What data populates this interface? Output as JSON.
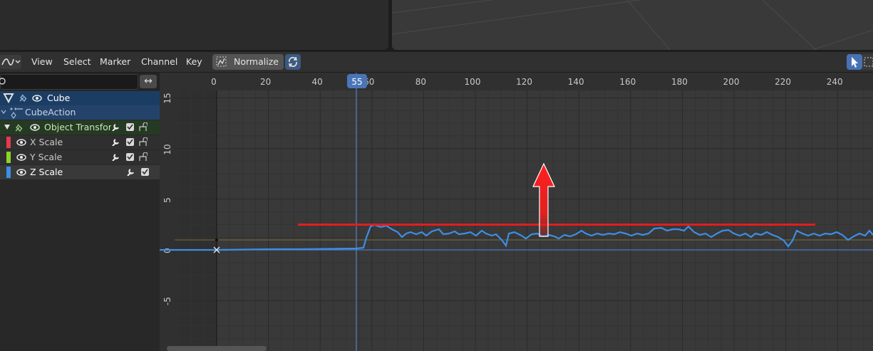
{
  "viewport": {},
  "header": {
    "menus": [
      "View",
      "Select",
      "Marker",
      "Channel",
      "Key"
    ],
    "normalize_label": "Normalize"
  },
  "channels": {
    "object": "Cube",
    "action": "CubeAction",
    "group": "Object Transform",
    "curves": [
      {
        "label": "X Scale",
        "color": "#e63a4e"
      },
      {
        "label": "Y Scale",
        "color": "#8bd426"
      },
      {
        "label": "Z Scale",
        "color": "#3d8ee6"
      }
    ]
  },
  "timeline": {
    "frame_ticks": [
      "0",
      "20",
      "40",
      "60",
      "80",
      "100",
      "120",
      "140",
      "160",
      "180",
      "200",
      "220",
      "240"
    ],
    "current_frame": "55",
    "value_ticks": [
      "15",
      "10",
      "5",
      "0",
      "-5"
    ]
  },
  "colors": {
    "curve": "#3d8ee6",
    "playhead": "#5680c2",
    "annotation": "#e01e1e",
    "selected_channel_bg": "#1c3d63"
  }
}
